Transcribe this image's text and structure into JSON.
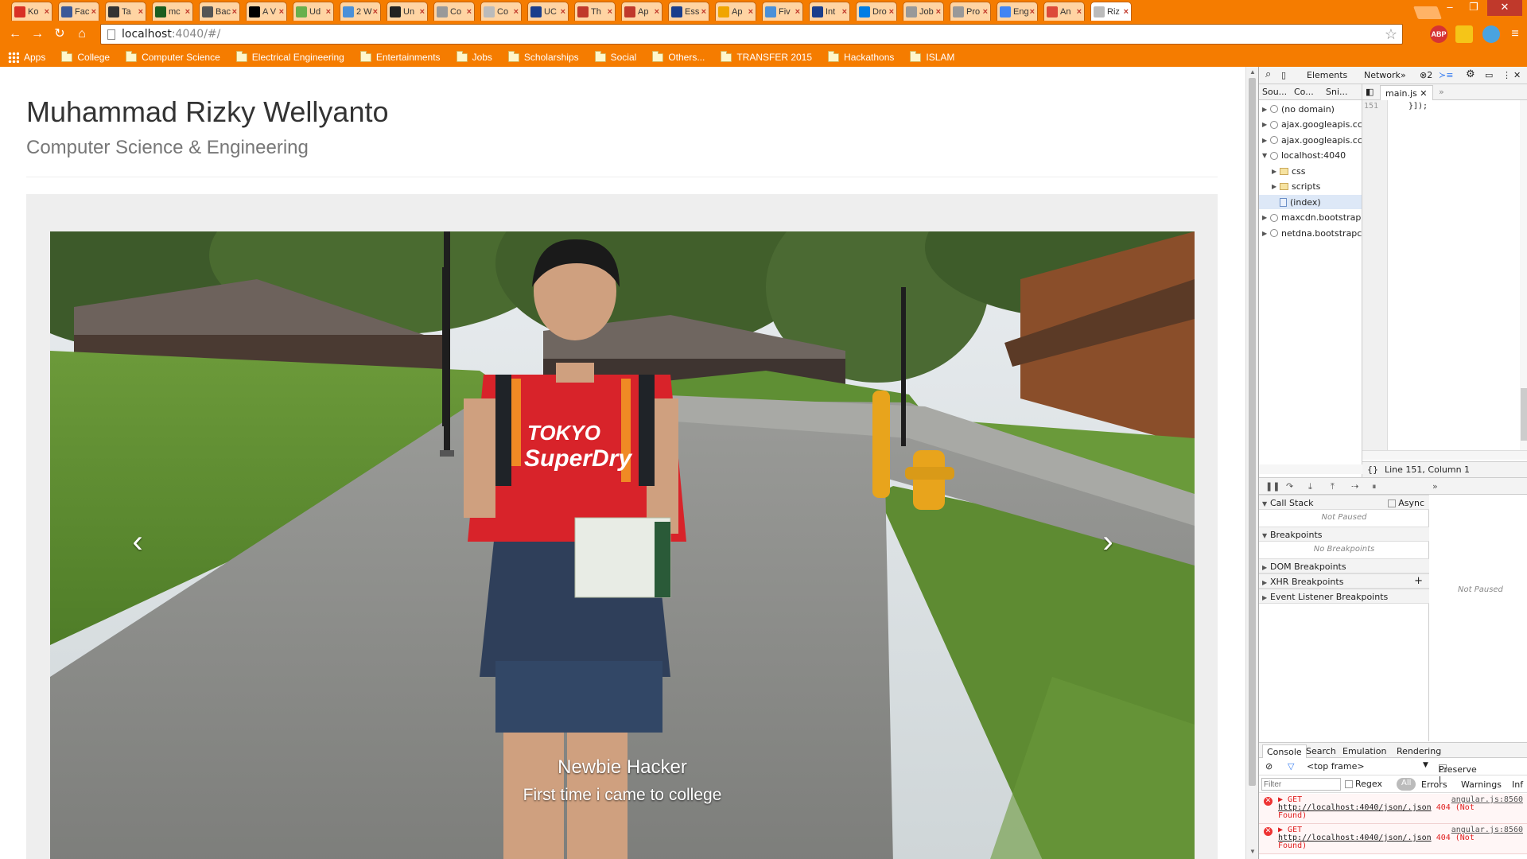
{
  "browser": {
    "tabs": [
      {
        "label": "Ko",
        "icon": "gmail-icon",
        "color": "#d93025"
      },
      {
        "label": "Fac",
        "icon": "facebook-icon",
        "color": "#3b5998"
      },
      {
        "label": "Ta",
        "icon": "tag-icon",
        "color": "#333333"
      },
      {
        "label": "mc",
        "icon": "mc-icon",
        "color": "#1b5e20"
      },
      {
        "label": "Bac",
        "icon": "glove-icon",
        "color": "#555555"
      },
      {
        "label": "A V",
        "icon": "medium-icon",
        "color": "#000000"
      },
      {
        "label": "Ud",
        "icon": "udemy-icon",
        "color": "#6ab04c"
      },
      {
        "label": "2 W",
        "icon": "share-icon",
        "color": "#4a90d9"
      },
      {
        "label": "Un",
        "icon": "vs-icon",
        "color": "#222222"
      },
      {
        "label": "Co",
        "icon": "page-icon",
        "color": "#999999"
      },
      {
        "label": "Co",
        "icon": "page-icon",
        "color": "#bbbbbb"
      },
      {
        "label": "UC",
        "icon": "uc-icon",
        "color": "#1a3e8c"
      },
      {
        "label": "Th",
        "icon": "ca-icon",
        "color": "#c0392b"
      },
      {
        "label": "Ap",
        "icon": "star-icon",
        "color": "#c0392b"
      },
      {
        "label": "Ess",
        "icon": "essay-icon",
        "color": "#1a3e8c"
      },
      {
        "label": "Ap",
        "icon": "w-icon",
        "color": "#f0a500"
      },
      {
        "label": "Fiv",
        "icon": "pinwheel-icon",
        "color": "#4a90d9"
      },
      {
        "label": "Int",
        "icon": "circle-icon",
        "color": "#1a3e8c"
      },
      {
        "label": "Dro",
        "icon": "dropbox-icon",
        "color": "#007ee5"
      },
      {
        "label": "Job",
        "icon": "page-icon",
        "color": "#999999"
      },
      {
        "label": "Pro",
        "icon": "page-icon",
        "color": "#999999"
      },
      {
        "label": "Eng",
        "icon": "google-icon",
        "color": "#4285f4"
      },
      {
        "label": "An",
        "icon": "gplus-icon",
        "color": "#dd4b39"
      },
      {
        "label": "Riz",
        "icon": "page-icon",
        "color": "#bbbbbb"
      }
    ],
    "url_host": "localhost",
    "url_rest": ":4040/#/",
    "bookmarks": [
      "Apps",
      "College",
      "Computer Science",
      "Electrical Engineering",
      "Entertainments",
      "Jobs",
      "Scholarships",
      "Social",
      "Others...",
      "TRANSFER 2015",
      "Hackathons",
      "ISLAM"
    ],
    "extensions": {
      "abp": "ABP"
    }
  },
  "page": {
    "title": "Muhammad Rizky Wellyanto",
    "subtitle": "Computer Science & Engineering",
    "carousel": {
      "caption_title": "Newbie Hacker",
      "caption_text": "First time i came to college",
      "prev_glyph": "‹",
      "next_glyph": "›"
    }
  },
  "devtools": {
    "toolbar": {
      "elements": "Elements",
      "network": "Network",
      "more": "»",
      "error_count": "2"
    },
    "source_tabs": [
      "Sou...",
      "Co...",
      "Sni..."
    ],
    "tree": [
      {
        "label": "(no domain)",
        "kind": "globe",
        "level": 0,
        "open": false
      },
      {
        "label": "ajax.googleapis.cc",
        "kind": "globe",
        "level": 0,
        "open": false
      },
      {
        "label": "ajax.googleapis.cc",
        "kind": "globe",
        "level": 0,
        "open": false
      },
      {
        "label": "localhost:4040",
        "kind": "globe",
        "level": 0,
        "open": true
      },
      {
        "label": "css",
        "kind": "folder",
        "level": 1,
        "open": false
      },
      {
        "label": "scripts",
        "kind": "folder",
        "level": 1,
        "open": false
      },
      {
        "label": "(index)",
        "kind": "doc",
        "level": 1,
        "open": false,
        "selected": true
      },
      {
        "label": "maxcdn.bootstrap",
        "kind": "globe",
        "level": 0,
        "open": false
      },
      {
        "label": "netdna.bootstrapc",
        "kind": "globe",
        "level": 0,
        "open": false
      }
    ],
    "editor": {
      "file": "main.js",
      "line_number": "151",
      "code": "}]);"
    },
    "status": "Line 151, Column 1",
    "call_stack": "Call Stack",
    "async": "Async",
    "not_paused": "Not Paused",
    "breakpoints": "Breakpoints",
    "no_breakpoints": "No Breakpoints",
    "dom_breakpoints": "DOM Breakpoints",
    "xhr_breakpoints": "XHR Breakpoints",
    "event_breakpoints": "Event Listener Breakpoints",
    "console_tabs": [
      "Console",
      "Search",
      "Emulation",
      "Rendering"
    ],
    "frame": "<top frame>",
    "preserve": "Preserve l",
    "filter_placeholder": "Filter",
    "regex": "Regex",
    "levels": [
      "All",
      "Errors",
      "Warnings",
      "Inf"
    ],
    "errors": [
      {
        "method": "GET",
        "url": "http://localhost:4040/json/.json",
        "status": "404 (Not",
        "status2": "Found)",
        "source": "angular.js:8560"
      },
      {
        "method": "GET",
        "url": "http://localhost:4040/json/.json",
        "status": "404 (Not",
        "status2": "Found)",
        "source": "angular.js:8560"
      }
    ]
  },
  "colors": {
    "chrome_orange": "#f57c00",
    "error_red": "#e02020"
  }
}
